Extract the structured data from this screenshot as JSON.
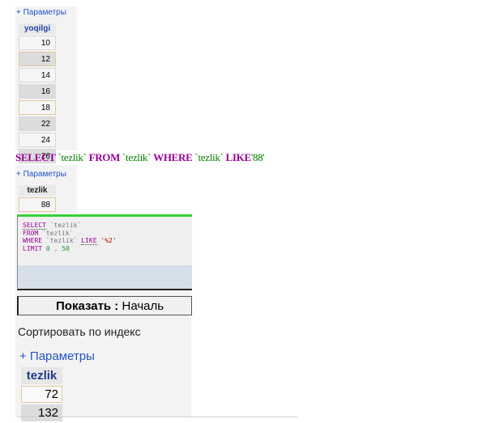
{
  "block1": {
    "params_label": "+ Параметры",
    "column_header": "yoqilgi",
    "rows": [
      "10",
      "12",
      "14",
      "16",
      "18",
      "22",
      "24",
      "26"
    ]
  },
  "query": {
    "select": "SELECT",
    "col": "`tezlik`",
    "from": "FROM",
    "table": "`tezlik`",
    "where": "WHERE",
    "wcol": "`tezlik`",
    "like": "LIKE",
    "value": "'88'"
  },
  "block2": {
    "params_label": "+ Параметры",
    "column_header": "tezlik",
    "rows": [
      "88"
    ]
  },
  "code": {
    "select": "SELECT",
    "col": "`tezlik`",
    "from": "FROM",
    "table": "`tezlik`",
    "where": "WHERE",
    "wcol": "`tezlik`",
    "like": "LIKE",
    "value": "'%2'",
    "limit": "LIMIT",
    "limit_start": "0",
    "limit_sep": ",",
    "limit_count": "50"
  },
  "show_bar": {
    "label": "Показать :",
    "value": "Началь"
  },
  "sort": {
    "text": "Сортировать по индекс"
  },
  "block3": {
    "params_label": "+ Параметры",
    "column_header": "tezlik",
    "rows": [
      "72",
      "132"
    ]
  },
  "colors": {
    "link": "#2355c5",
    "keyword": "#990099",
    "identifier": "#008000",
    "code_border_top": "#34d234"
  }
}
